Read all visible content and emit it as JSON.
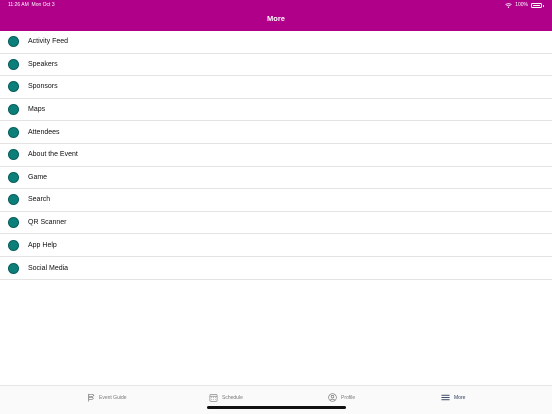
{
  "status_bar": {
    "time": "11:26 AM",
    "date": "Mon Oct 3",
    "battery": "100%"
  },
  "header": {
    "title": "More",
    "color": "#b0008a"
  },
  "menu": {
    "icon_color": "#0c7f7a",
    "items": [
      {
        "label": "Activity Feed"
      },
      {
        "label": "Speakers"
      },
      {
        "label": "Sponsors"
      },
      {
        "label": "Maps"
      },
      {
        "label": "Attendees"
      },
      {
        "label": "About the Event"
      },
      {
        "label": "Game"
      },
      {
        "label": "Search"
      },
      {
        "label": "QR Scanner"
      },
      {
        "label": "App Help"
      },
      {
        "label": "Social Media"
      }
    ]
  },
  "tabbar": {
    "tabs": [
      {
        "label": "Event Guide",
        "icon": "signpost-icon"
      },
      {
        "label": "Schedule",
        "icon": "calendar-icon"
      },
      {
        "label": "Profile",
        "icon": "person-icon"
      },
      {
        "label": "More",
        "icon": "hamburger-icon",
        "active": true
      }
    ]
  }
}
